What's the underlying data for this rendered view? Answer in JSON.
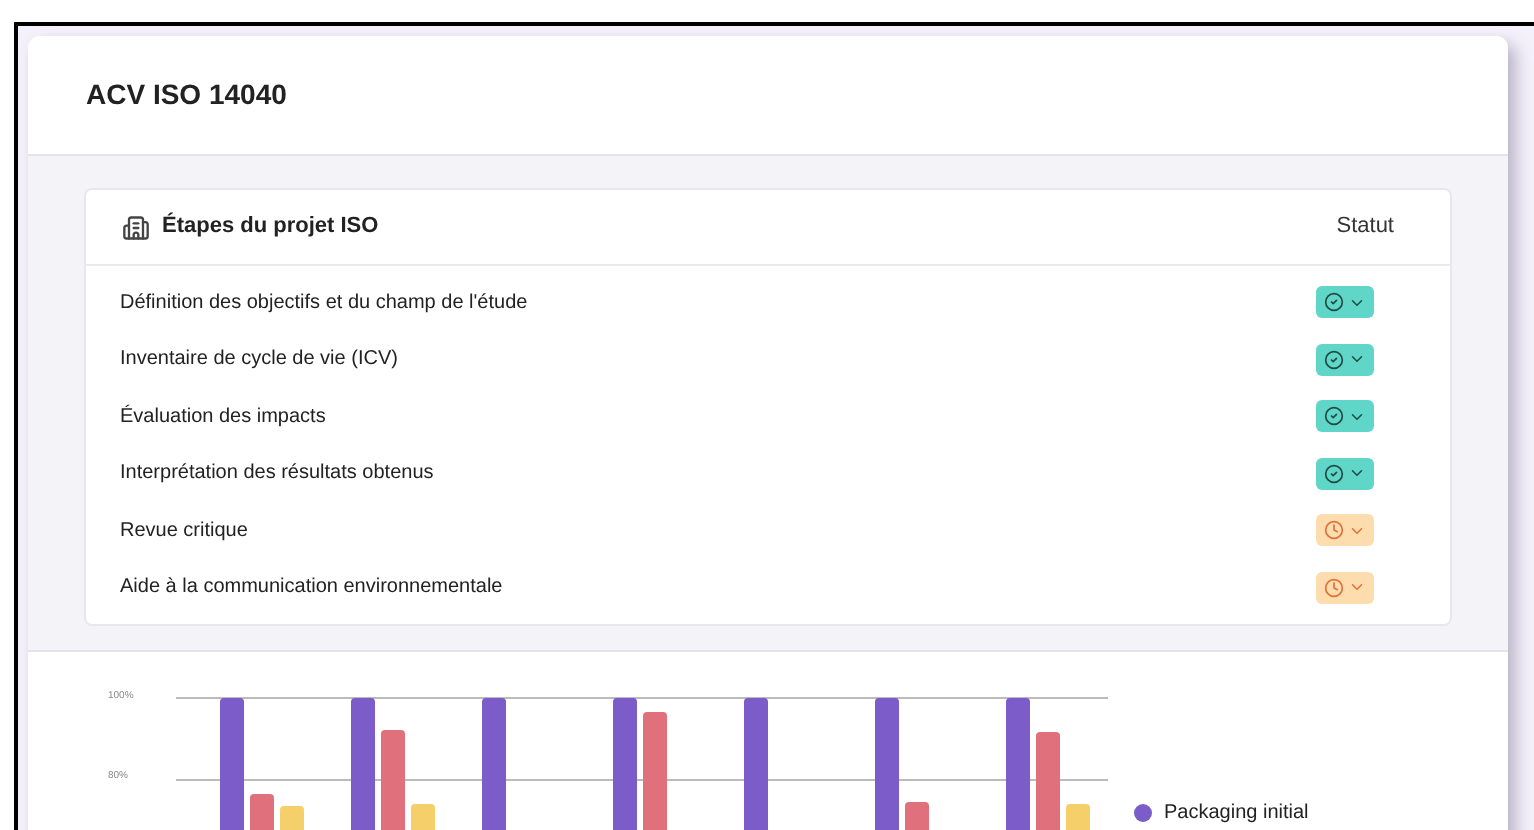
{
  "card": {
    "title": "ACV ISO 14040"
  },
  "steps_table": {
    "title": "Étapes du projet ISO",
    "status_header": "Statut",
    "rows": [
      {
        "label": "Définition des objectifs et du champ de l'étude",
        "kind": "done"
      },
      {
        "label": "Inventaire de cycle de vie (ICV)",
        "kind": "done"
      },
      {
        "label": "Évaluation des impacts",
        "kind": "done"
      },
      {
        "label": "Interprétation des résultats obtenus",
        "kind": "done"
      },
      {
        "label": "Revue critique",
        "kind": "pending"
      },
      {
        "label": "Aide à la communication environnementale",
        "kind": "pending"
      }
    ]
  },
  "chart": {
    "tick_labels": [
      "100%",
      "80%"
    ],
    "legend": [
      {
        "label": "Packaging initial",
        "color": "#7b5cc9"
      }
    ]
  }
}
